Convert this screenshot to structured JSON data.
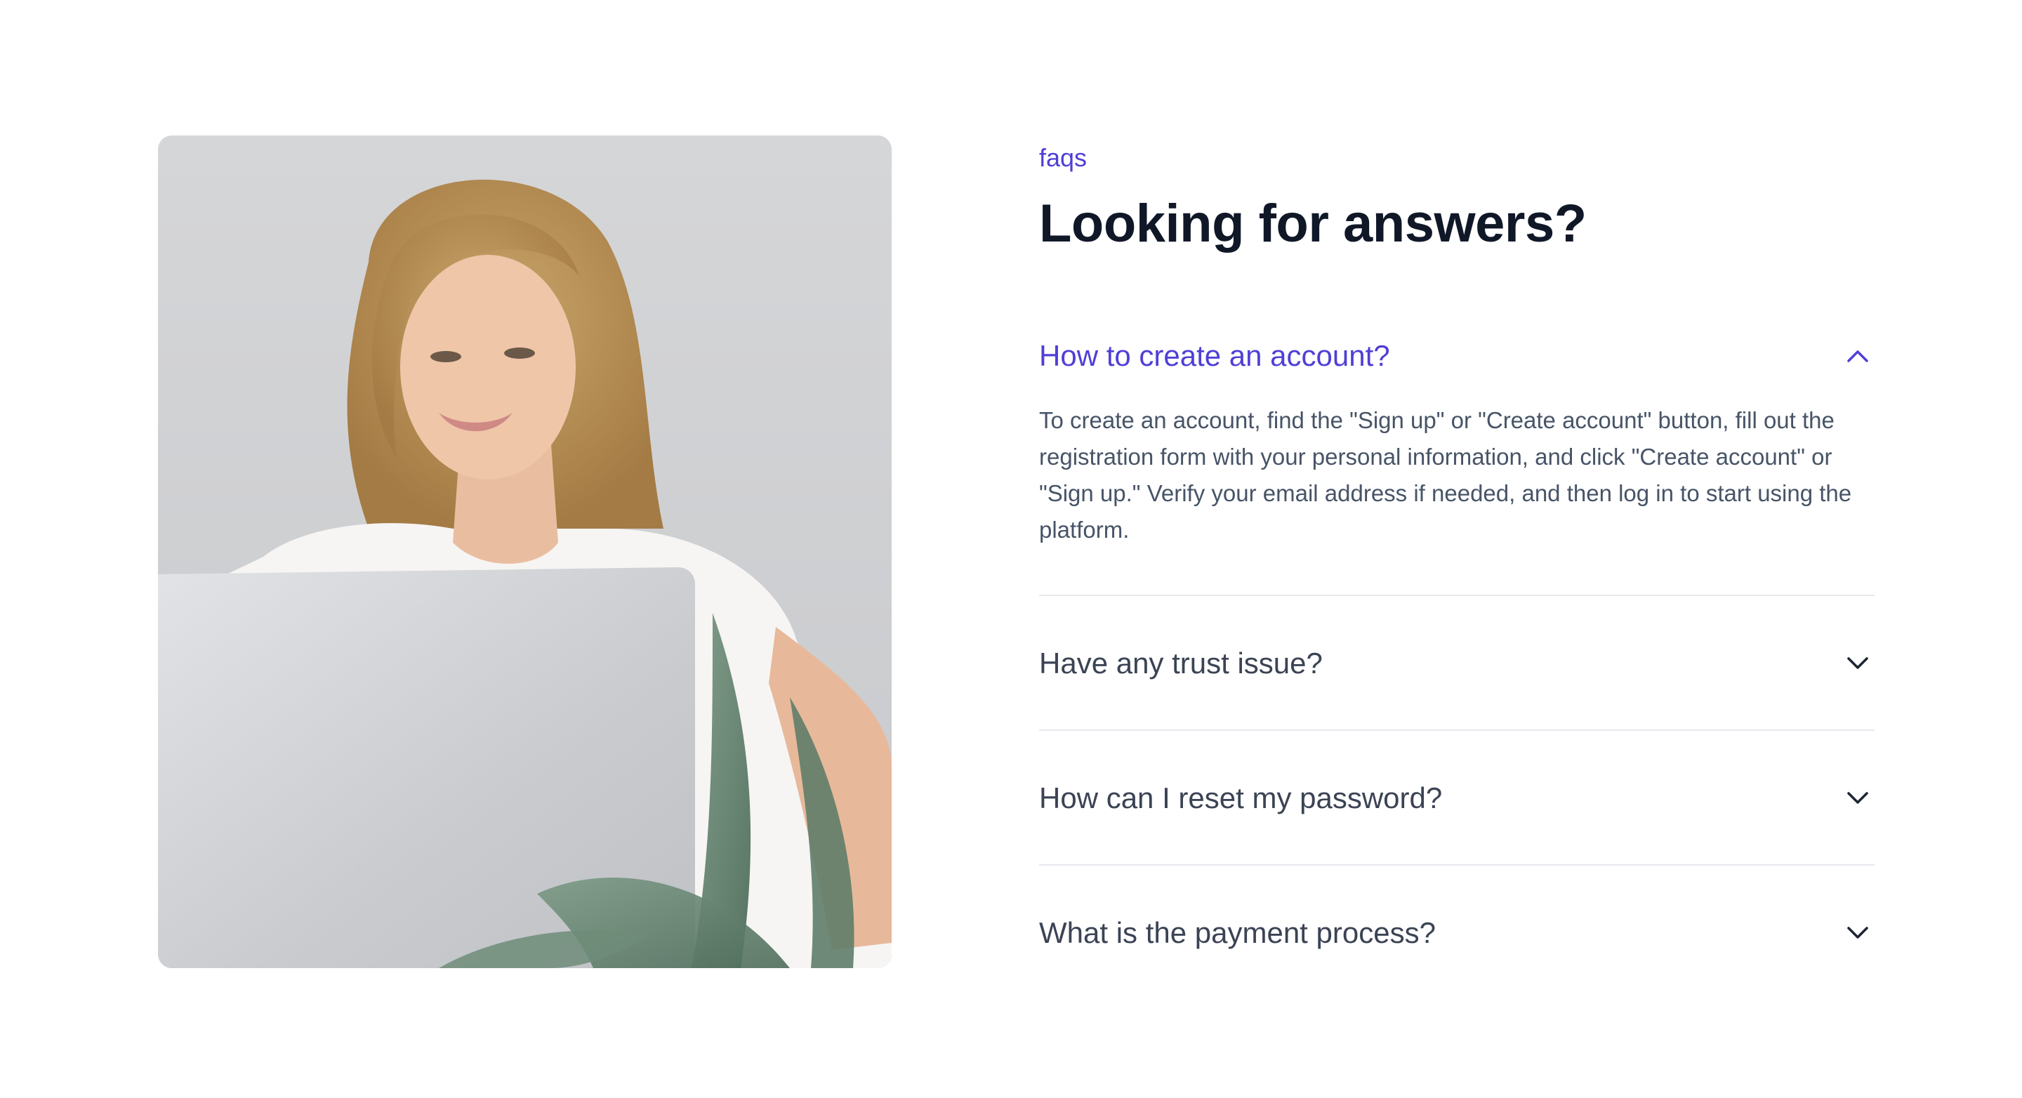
{
  "faq": {
    "eyebrow": "faqs",
    "title": "Looking for answers?",
    "items": [
      {
        "question": "How to create an account?",
        "answer": "To create an account, find the \"Sign up\" or \"Create account\" button, fill out the registration form with your personal information, and click \"Create account\" or \"Sign up.\" Verify your email address if needed, and then log in to start using the platform.",
        "expanded": true
      },
      {
        "question": "Have any trust issue?",
        "expanded": false
      },
      {
        "question": "How can I reset my password?",
        "expanded": false
      },
      {
        "question": "What is the payment process?",
        "expanded": false
      }
    ]
  },
  "icons": {
    "expanded": "chevron-up-icon",
    "collapsed": "chevron-down-icon"
  },
  "colors": {
    "accent": "#4f3fd7",
    "heading": "#101828",
    "body_text": "#475467",
    "question_text": "#3b4354",
    "divider": "#e6e8ec"
  }
}
